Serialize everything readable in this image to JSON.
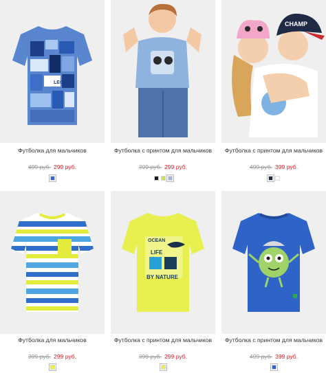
{
  "products": [
    {
      "name": "Футболка для мальчиков",
      "old_price": "499 руб.",
      "price": "299 руб.",
      "colors": [
        "#3a67c4"
      ],
      "image": "boys-tshirt-blue-photo-print"
    },
    {
      "name": "Футболка с принтом для мальчиков",
      "old_price": "399 руб.",
      "price": "299 руб.",
      "colors": [
        "#1d1d1f",
        "#cbe34a",
        "#9ab8dd"
      ],
      "image": "boy-model-light-blue-tshirt"
    },
    {
      "name": "Футболка с принтом для мальчиков",
      "old_price": "499 руб.",
      "price": "399 руб.",
      "colors": [
        "#1f2a44",
        "#ffffff"
      ],
      "image": "kids-models-caps"
    },
    {
      "name": "Футболка для мальчиков",
      "old_price": "399 руб.",
      "price": "299 руб.",
      "colors": [
        "#e9f04a"
      ],
      "image": "boys-tshirt-striped"
    },
    {
      "name": "Футболка с принтом для мальчиков",
      "old_price": "399 руб.",
      "price": "299 руб.",
      "colors": [
        "#e9f04a"
      ],
      "image": "boys-tshirt-lime-print"
    },
    {
      "name": "Футболка с принтом для мальчиков",
      "old_price": "499 руб.",
      "price": "399 руб.",
      "colors": [
        "#2f63c8"
      ],
      "image": "boys-tshirt-royal-blue-print"
    }
  ],
  "print_text": {
    "legend": "LEGEND",
    "ocean": "OCEAN",
    "life": "LIFE",
    "by_nature": "BY NATURE",
    "champ": "CHAMP"
  }
}
